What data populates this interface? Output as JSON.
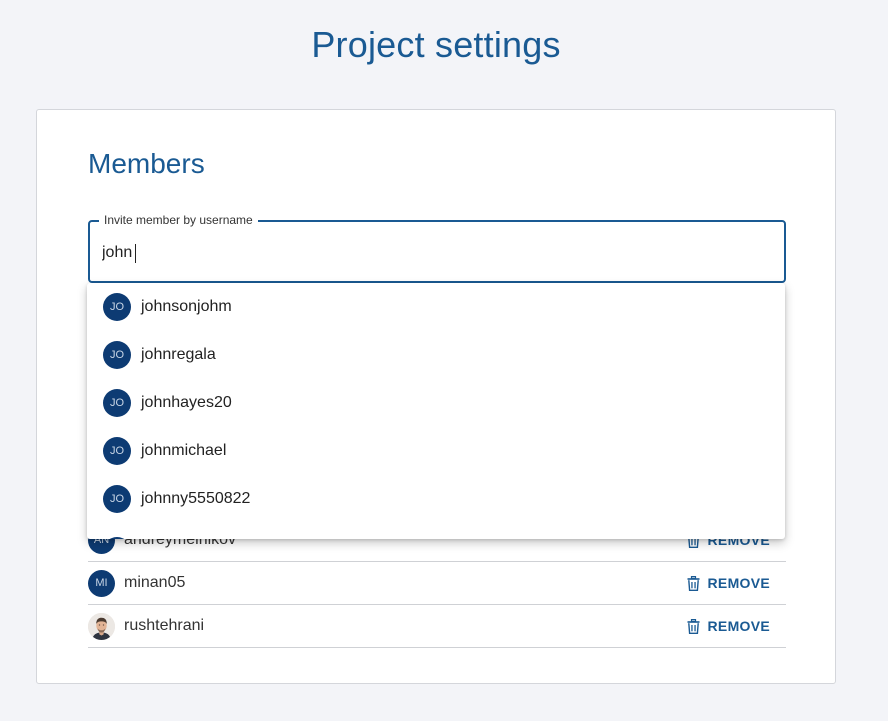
{
  "page_title": "Project settings",
  "members_section": {
    "title": "Members",
    "invite": {
      "label": "Invite member by username",
      "value": "john"
    }
  },
  "suggestions": [
    {
      "initials": "JO",
      "username": "johnsonjohm"
    },
    {
      "initials": "JO",
      "username": "johnregala"
    },
    {
      "initials": "JO",
      "username": "johnhayes20"
    },
    {
      "initials": "JO",
      "username": "johnmichael"
    },
    {
      "initials": "JO",
      "username": "johnny5550822"
    },
    {
      "initials": "JO",
      "username": ""
    }
  ],
  "members": [
    {
      "initials": "AN",
      "username": "andreymelnikov",
      "remove_label": "REMOVE"
    },
    {
      "initials": "MI",
      "username": "minan05",
      "remove_label": "REMOVE"
    },
    {
      "initials": "",
      "username": "rushtehrani",
      "remove_label": "REMOVE",
      "avatar": "photo"
    }
  ],
  "colors": {
    "accent": "#1a5a93",
    "avatar_bg": "#0d3b73",
    "page_bg": "#f3f4f8"
  }
}
